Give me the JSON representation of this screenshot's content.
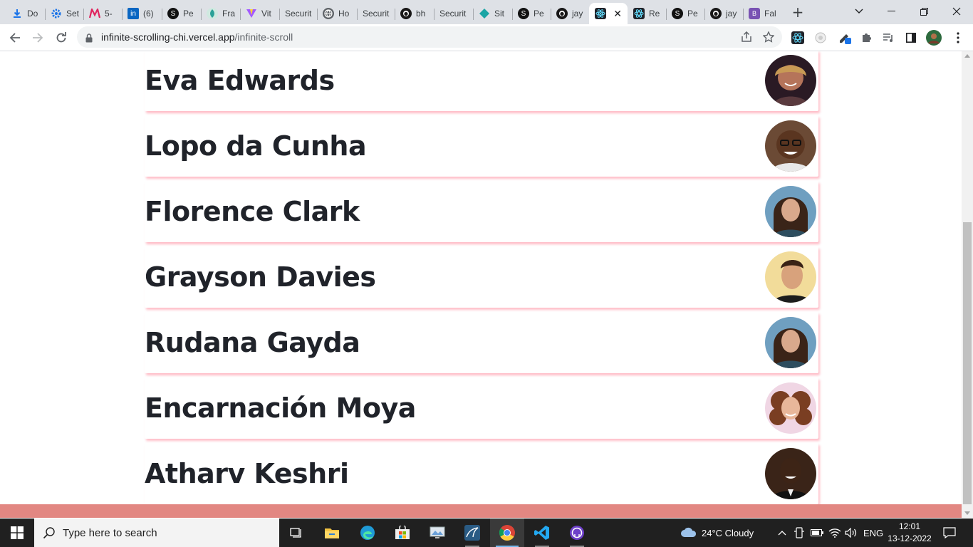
{
  "browser": {
    "tabs": [
      {
        "title": "Do",
        "icon": "download-icon"
      },
      {
        "title": "Set",
        "icon": "settings-icon"
      },
      {
        "title": "5-",
        "icon": "m-logo-icon"
      },
      {
        "title": "(6)",
        "icon": "linkedin-icon"
      },
      {
        "title": "Pe",
        "icon": "s-logo-icon"
      },
      {
        "title": "Fra",
        "icon": "leaf-icon"
      },
      {
        "title": "Vit",
        "icon": "vite-icon"
      },
      {
        "title": "Securit",
        "icon": "blank-icon"
      },
      {
        "title": "Ho",
        "icon": "globe-icon"
      },
      {
        "title": "Securit",
        "icon": "blank-icon"
      },
      {
        "title": "bh",
        "icon": "github-icon"
      },
      {
        "title": "Securit",
        "icon": "blank-icon"
      },
      {
        "title": "Sit",
        "icon": "diamond-icon"
      },
      {
        "title": "Pe",
        "icon": "s-logo-icon"
      },
      {
        "title": "jay",
        "icon": "github-icon"
      },
      {
        "title": "",
        "icon": "react-icon",
        "active": true
      },
      {
        "title": "Re",
        "icon": "react-icon"
      },
      {
        "title": "Pe",
        "icon": "s-logo-icon"
      },
      {
        "title": "jay",
        "icon": "github-icon"
      },
      {
        "title": "Fal",
        "icon": "bootstrap-icon"
      }
    ],
    "url_host": "infinite-scrolling-chi.vercel.app",
    "url_path": "/infinite-scroll"
  },
  "page": {
    "users": [
      {
        "name": "Eva Edwards"
      },
      {
        "name": "Lopo da Cunha"
      },
      {
        "name": "Florence Clark"
      },
      {
        "name": "Grayson Davies"
      },
      {
        "name": "Rudana Gayda"
      },
      {
        "name": "Encarnación Moya"
      },
      {
        "name": "Atharv Keshri"
      }
    ],
    "footer_color": "#e28782",
    "shadow_color": "#ffb6c1"
  },
  "taskbar": {
    "search_placeholder": "Type here to search",
    "weather": "24°C  Cloudy",
    "language": "ENG",
    "time": "12:01",
    "date": "13-12-2022"
  }
}
